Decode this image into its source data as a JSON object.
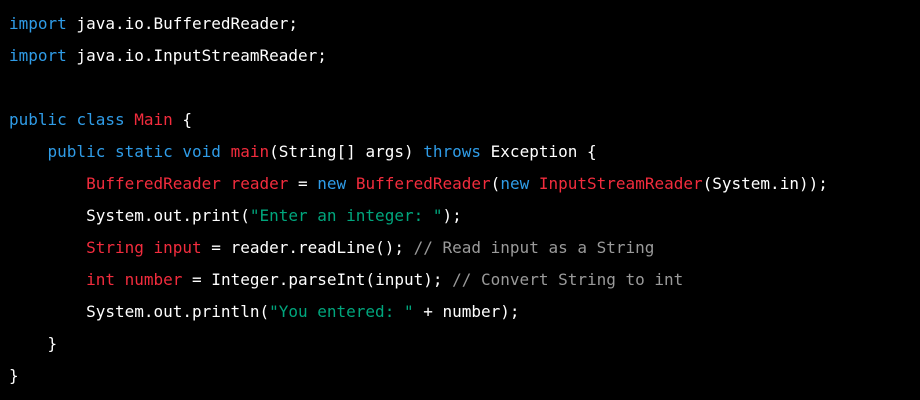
{
  "colors": {
    "background": "#000000",
    "plain": "#ffffff",
    "keyword": "#2f9ce7",
    "type": "#f22c3d",
    "string": "#00a67d",
    "comment": "#9a9a9a"
  },
  "code": {
    "language": "java",
    "lines": [
      [
        {
          "t": "kw",
          "v": "import"
        },
        {
          "t": "id",
          "v": " java.io.BufferedReader;"
        }
      ],
      [
        {
          "t": "kw",
          "v": "import"
        },
        {
          "t": "id",
          "v": " java.io.InputStreamReader;"
        }
      ],
      [],
      [
        {
          "t": "kw",
          "v": "public"
        },
        {
          "t": "id",
          "v": " "
        },
        {
          "t": "kw",
          "v": "class"
        },
        {
          "t": "id",
          "v": " "
        },
        {
          "t": "type",
          "v": "Main"
        },
        {
          "t": "id",
          "v": " {"
        }
      ],
      [
        {
          "t": "id",
          "v": "    "
        },
        {
          "t": "kw",
          "v": "public"
        },
        {
          "t": "id",
          "v": " "
        },
        {
          "t": "kw",
          "v": "static"
        },
        {
          "t": "id",
          "v": " "
        },
        {
          "t": "kw",
          "v": "void"
        },
        {
          "t": "id",
          "v": " "
        },
        {
          "t": "type",
          "v": "main"
        },
        {
          "t": "id",
          "v": "(String[] args) "
        },
        {
          "t": "kw",
          "v": "throws"
        },
        {
          "t": "id",
          "v": " Exception {"
        }
      ],
      [
        {
          "t": "id",
          "v": "        "
        },
        {
          "t": "type",
          "v": "BufferedReader"
        },
        {
          "t": "id",
          "v": " "
        },
        {
          "t": "type",
          "v": "reader"
        },
        {
          "t": "id",
          "v": " = "
        },
        {
          "t": "kw",
          "v": "new"
        },
        {
          "t": "id",
          "v": " "
        },
        {
          "t": "type",
          "v": "BufferedReader"
        },
        {
          "t": "id",
          "v": "("
        },
        {
          "t": "kw",
          "v": "new"
        },
        {
          "t": "id",
          "v": " "
        },
        {
          "t": "type",
          "v": "InputStreamReader"
        },
        {
          "t": "id",
          "v": "(System.in));"
        }
      ],
      [
        {
          "t": "id",
          "v": "        System.out.print("
        },
        {
          "t": "str",
          "v": "\"Enter an integer: \""
        },
        {
          "t": "id",
          "v": ");"
        }
      ],
      [
        {
          "t": "id",
          "v": "        "
        },
        {
          "t": "type",
          "v": "String"
        },
        {
          "t": "id",
          "v": " "
        },
        {
          "t": "type",
          "v": "input"
        },
        {
          "t": "id",
          "v": " = reader.readLine(); "
        },
        {
          "t": "cm",
          "v": "// Read input as a String"
        }
      ],
      [
        {
          "t": "id",
          "v": "        "
        },
        {
          "t": "type",
          "v": "int"
        },
        {
          "t": "id",
          "v": " "
        },
        {
          "t": "type",
          "v": "number"
        },
        {
          "t": "id",
          "v": " = Integer.parseInt(input); "
        },
        {
          "t": "cm",
          "v": "// Convert String to int"
        }
      ],
      [
        {
          "t": "id",
          "v": "        System.out.println("
        },
        {
          "t": "str",
          "v": "\"You entered: \""
        },
        {
          "t": "id",
          "v": " + number);"
        }
      ],
      [
        {
          "t": "id",
          "v": "    }"
        }
      ],
      [
        {
          "t": "id",
          "v": "}"
        }
      ]
    ]
  }
}
